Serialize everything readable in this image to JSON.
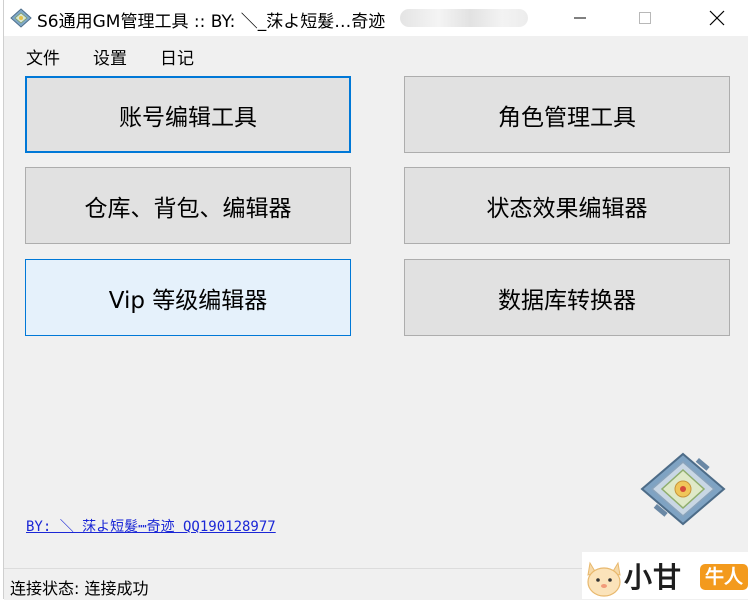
{
  "window": {
    "title": "S6通用GM管理工具 :: BY: ＼_莯よ短髮…奇迹",
    "controls": {
      "minimize": "—",
      "maximize": "☐",
      "close": "✕"
    }
  },
  "menu": {
    "items": [
      "文件",
      "设置",
      "日记"
    ]
  },
  "buttons": {
    "account_editor": "账号编辑工具",
    "role_manager": "角色管理工具",
    "inventory_editor": "仓库、背包、编辑器",
    "status_effect_editor": "状态效果编辑器",
    "vip_editor": "Vip 等级编辑器",
    "database_converter": "数据库转换器"
  },
  "credit_link": "BY: ＼ 莯よ短髮┉奇迹 QQ190128977",
  "status": {
    "text": "连接状态: 连接成功"
  },
  "watermark": {
    "text": "小甘",
    "badge": "牛人"
  },
  "icons": {
    "app_icon": "gm-tool-icon",
    "logo": "gm-logo-icon"
  }
}
